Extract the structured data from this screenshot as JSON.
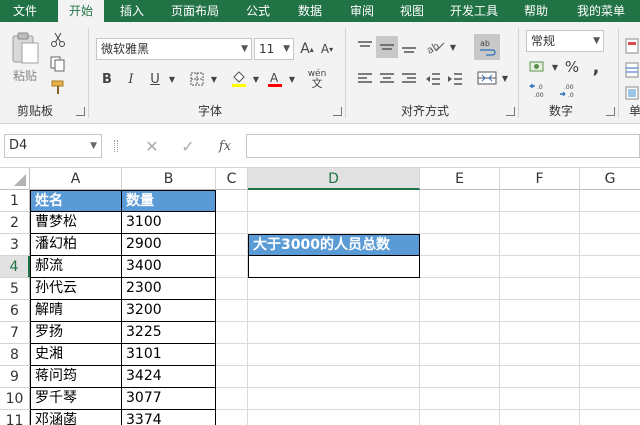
{
  "tabs": [
    "文件",
    "开始",
    "插入",
    "页面布局",
    "公式",
    "数据",
    "审阅",
    "视图",
    "开发工具",
    "帮助",
    "我的菜单"
  ],
  "ribbon": {
    "clipboard": {
      "paste_label": "粘贴",
      "group_label": "剪贴板"
    },
    "font": {
      "font_name": "微软雅黑",
      "font_size": "11",
      "grow_label": "A",
      "shrink_label": "A",
      "bold": "B",
      "italic": "I",
      "underline": "U",
      "phonetic": "wén",
      "group_label": "字体"
    },
    "alignment": {
      "group_label": "对齐方式"
    },
    "number": {
      "format": "常规",
      "percent": "%",
      "comma": ",",
      "group_label": "数字"
    },
    "styles": {
      "partial_label": "单"
    }
  },
  "formula_bar": {
    "name_box": "D4",
    "cancel": "✕",
    "enter": "✓",
    "fx": "fx",
    "value": ""
  },
  "columns": [
    "A",
    "B",
    "C",
    "D",
    "E",
    "F",
    "G"
  ],
  "selected_column": "D",
  "rows": [
    "1",
    "2",
    "3",
    "4",
    "5",
    "6",
    "7",
    "8",
    "9",
    "10",
    "11"
  ],
  "selected_row": "4",
  "table": {
    "headers": [
      "姓名",
      "数量"
    ],
    "rows": [
      [
        "曹梦松",
        "3100"
      ],
      [
        "潘幻柏",
        "2900"
      ],
      [
        "郝流",
        "3400"
      ],
      [
        "孙代云",
        "2300"
      ],
      [
        "解晴",
        "3200"
      ],
      [
        "罗扬",
        "3225"
      ],
      [
        "史湘",
        "3101"
      ],
      [
        "蒋问筠",
        "3424"
      ],
      [
        "罗千琴",
        "3077"
      ],
      [
        "邓涵菡",
        "3374"
      ]
    ]
  },
  "summary": {
    "title": "大于3000的人员总数",
    "value": ""
  },
  "colors": {
    "accent": "#217346",
    "header_fill": "#5b9bd5",
    "font_red": "#ff0000",
    "fill_yellow": "#ffff00"
  }
}
